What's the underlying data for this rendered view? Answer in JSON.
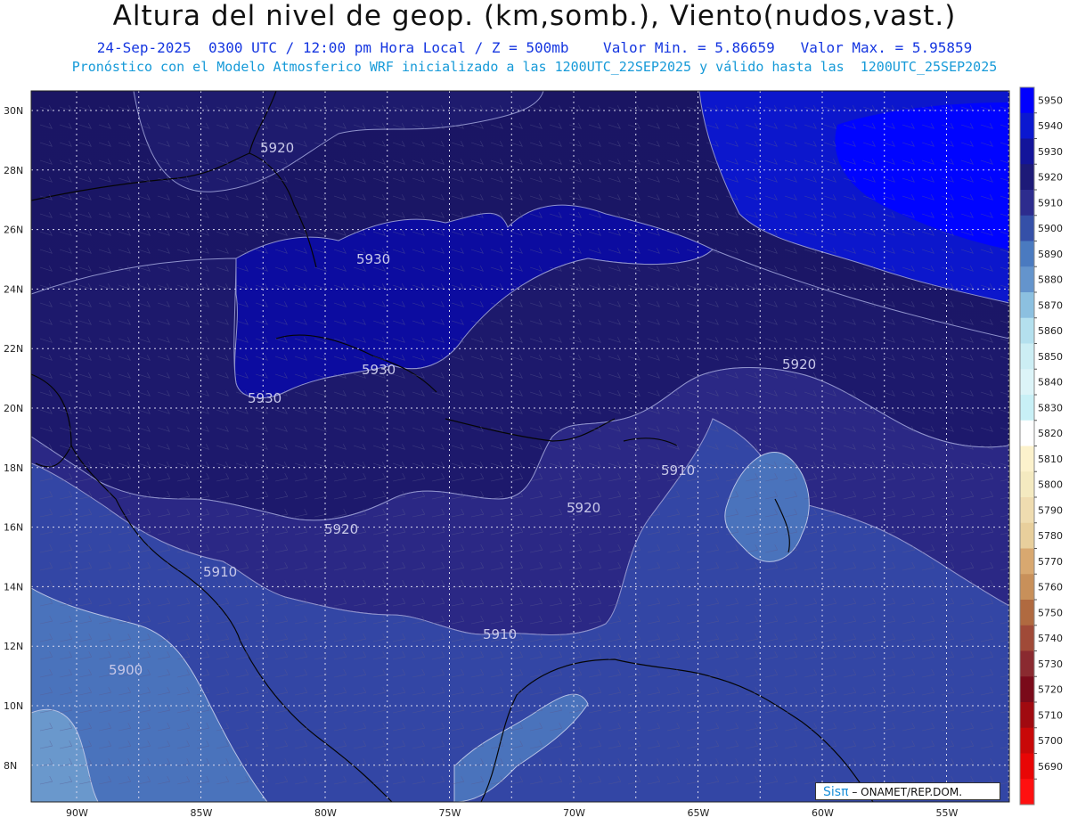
{
  "title": "Altura del nivel de geop. (km,somb.), Viento(nudos,vast.)",
  "subtitle1": "24-Sep-2025  0300 UTC / 12:00 pm Hora Local / Z = 500mb    Valor Min. = 5.86659   Valor Max. = 5.95859",
  "subtitle2": "Pronóstico con el Modelo Atmosferico WRF inicializado a las 1200UTC_22SEP2025 y válido hasta las  1200UTC_25SEP2025",
  "axes": {
    "lat_labels": [
      "30N",
      "28N",
      "26N",
      "24N",
      "22N",
      "20N",
      "18N",
      "16N",
      "14N",
      "12N",
      "10N",
      "8N"
    ],
    "lon_labels": [
      "90W",
      "85W",
      "80W",
      "75W",
      "70W",
      "65W",
      "60W",
      "55W"
    ]
  },
  "contour_labels": [
    {
      "text": "5920"
    },
    {
      "text": "5930"
    },
    {
      "text": "5930"
    },
    {
      "text": "5930"
    },
    {
      "text": "5920"
    },
    {
      "text": "5910"
    },
    {
      "text": "5920"
    },
    {
      "text": "5920"
    },
    {
      "text": "5910"
    },
    {
      "text": "5910"
    },
    {
      "text": "5900"
    }
  ],
  "colorbar": {
    "levels": [
      "5950",
      "5940",
      "5930",
      "5920",
      "5910",
      "5900",
      "5890",
      "5880",
      "5870",
      "5860",
      "5850",
      "5840",
      "5830",
      "5820",
      "5810",
      "5800",
      "5790",
      "5780",
      "5770",
      "5760",
      "5750",
      "5740",
      "5730",
      "5720",
      "5710",
      "5700",
      "5690"
    ],
    "colors": [
      "#0000fe",
      "#0b18d0",
      "#13149a",
      "#1d1a78",
      "#2d2c8e",
      "#3550a8",
      "#4a7ac0",
      "#6494cc",
      "#8cc0e0",
      "#b4e0ee",
      "#cceef4",
      "#dcf4f8",
      "#c8f0f6",
      "#ffffff",
      "#fcf2cc",
      "#f4eac0",
      "#efdcb0",
      "#e8cf9c",
      "#d8a870",
      "#c8905a",
      "#b06a40",
      "#a04a38",
      "#8a2a30",
      "#7a0a1a",
      "#a00a10",
      "#c80808",
      "#e80606",
      "#ff1010"
    ]
  },
  "logo": {
    "sis": "Sisπ",
    "text": "– ONAMET/REP.DOM."
  },
  "colors": {
    "deep": "#1b1665",
    "mid": "#2a2780",
    "light": "#3443a0",
    "lighter": "#3f5db2",
    "lightest": "#5a84c2",
    "high": "#0b18cf",
    "max": "#0004ff"
  }
}
